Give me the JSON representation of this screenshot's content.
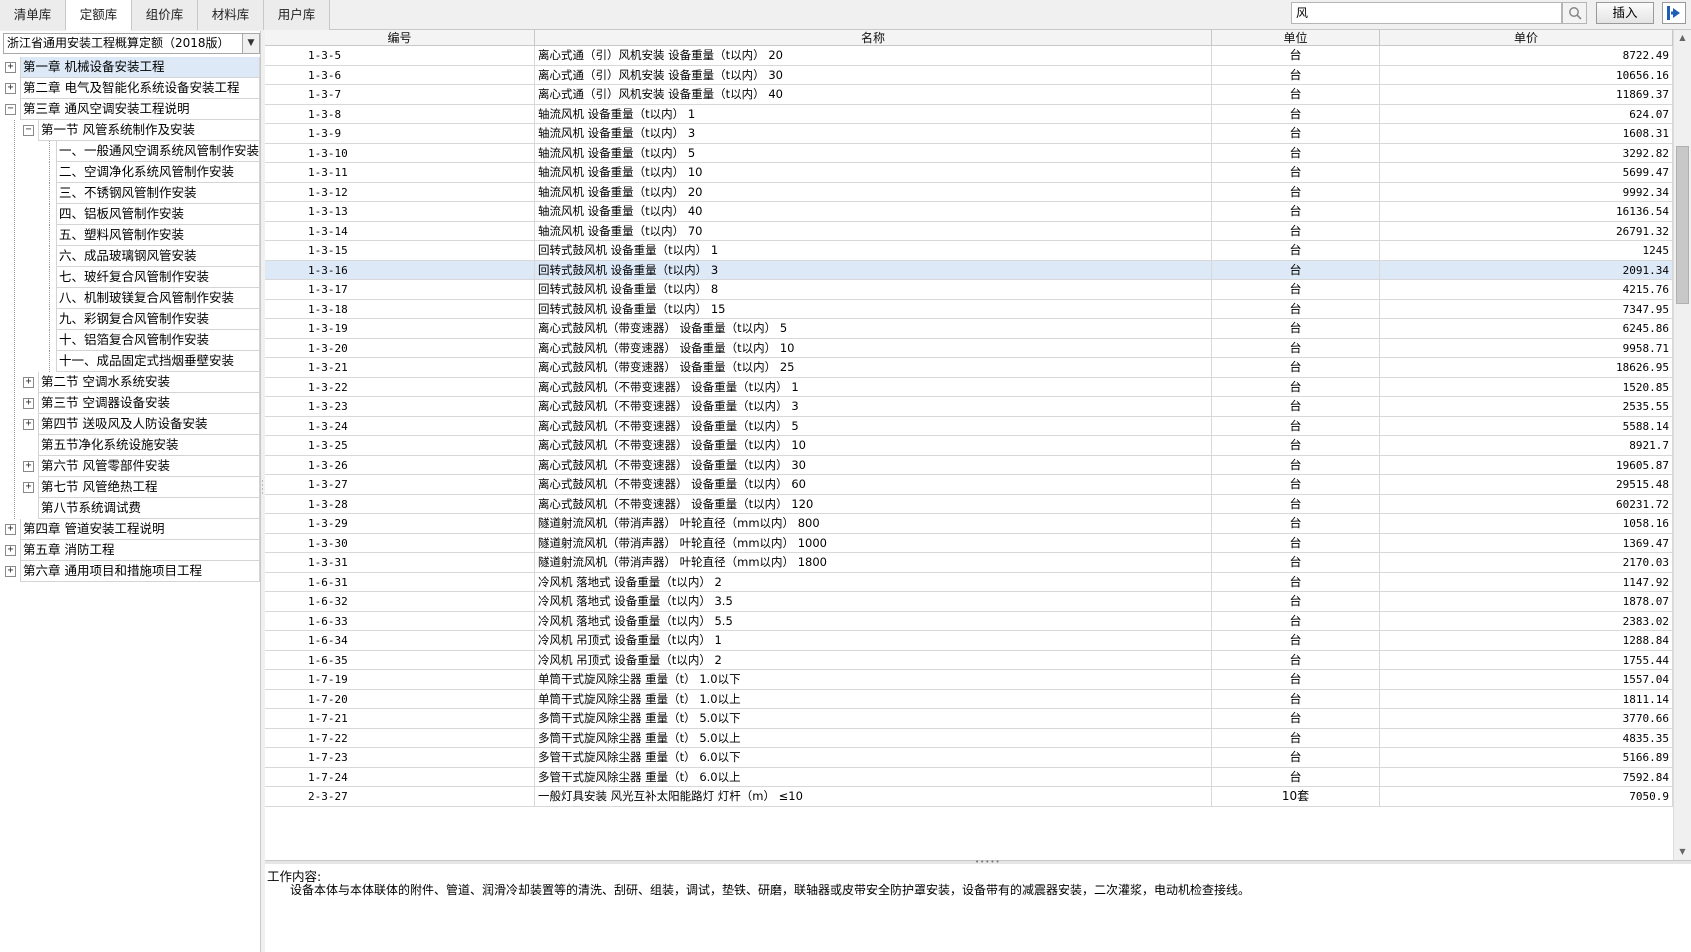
{
  "tabs": [
    "清单库",
    "定额库",
    "组价库",
    "材料库",
    "用户库"
  ],
  "active_tab": 1,
  "search": {
    "value": "风",
    "placeholder": ""
  },
  "insert_label": "插入",
  "left": {
    "combo_value": "浙江省通用安装工程概算定额（2018版）",
    "tree": [
      {
        "label": "第一章 机械设备安装工程",
        "level": 0,
        "expander": "+",
        "selected": true
      },
      {
        "label": "第二章 电气及智能化系统设备安装工程",
        "level": 0,
        "expander": "+"
      },
      {
        "label": "第三章 通风空调安装工程说明",
        "level": 0,
        "expander": "-"
      },
      {
        "label": "第一节 风管系统制作及安装",
        "level": 1,
        "expander": "-"
      },
      {
        "label": "一、一般通风空调系统风管制作安装",
        "level": 2
      },
      {
        "label": "二、空调净化系统风管制作安装",
        "level": 2
      },
      {
        "label": "三、不锈钢风管制作安装",
        "level": 2
      },
      {
        "label": "四、铝板风管制作安装",
        "level": 2
      },
      {
        "label": "五、塑料风管制作安装",
        "level": 2
      },
      {
        "label": "六、成品玻璃钢风管安装",
        "level": 2
      },
      {
        "label": "七、玻纤复合风管制作安装",
        "level": 2
      },
      {
        "label": "八、机制玻镁复合风管制作安装",
        "level": 2
      },
      {
        "label": "九、彩钢复合风管制作安装",
        "level": 2
      },
      {
        "label": "十、铝箔复合风管制作安装",
        "level": 2
      },
      {
        "label": "十一、成品固定式挡烟垂壁安装",
        "level": 2
      },
      {
        "label": "第二节 空调水系统安装",
        "level": 1,
        "expander": "+"
      },
      {
        "label": "第三节 空调器设备安装",
        "level": 1,
        "expander": "+"
      },
      {
        "label": "第四节 送吸风及人防设备安装",
        "level": 1,
        "expander": "+"
      },
      {
        "label": "第五节净化系统设施安装",
        "level": 1
      },
      {
        "label": "第六节 风管零部件安装",
        "level": 1,
        "expander": "+"
      },
      {
        "label": "第七节 风管绝热工程",
        "level": 1,
        "expander": "+"
      },
      {
        "label": "第八节系统调试费",
        "level": 1
      },
      {
        "label": "第四章 管道安装工程说明",
        "level": 0,
        "expander": "+"
      },
      {
        "label": "第五章 消防工程",
        "level": 0,
        "expander": "+"
      },
      {
        "label": "第六章 通用项目和措施项目工程",
        "level": 0,
        "expander": "+"
      }
    ]
  },
  "grid": {
    "headers": [
      "编号",
      "名称",
      "单位",
      "单价"
    ],
    "selected_row": 11,
    "rows": [
      [
        "1-3-5",
        "离心式通（引）风机安装 设备重量（t以内） 20",
        "台",
        "8722.49"
      ],
      [
        "1-3-6",
        "离心式通（引）风机安装 设备重量（t以内） 30",
        "台",
        "10656.16"
      ],
      [
        "1-3-7",
        "离心式通（引）风机安装 设备重量（t以内） 40",
        "台",
        "11869.37"
      ],
      [
        "1-3-8",
        "轴流风机 设备重量（t以内） 1",
        "台",
        "624.07"
      ],
      [
        "1-3-9",
        "轴流风机 设备重量（t以内） 3",
        "台",
        "1608.31"
      ],
      [
        "1-3-10",
        "轴流风机 设备重量（t以内） 5",
        "台",
        "3292.82"
      ],
      [
        "1-3-11",
        "轴流风机 设备重量（t以内） 10",
        "台",
        "5699.47"
      ],
      [
        "1-3-12",
        "轴流风机 设备重量（t以内） 20",
        "台",
        "9992.34"
      ],
      [
        "1-3-13",
        "轴流风机 设备重量（t以内） 40",
        "台",
        "16136.54"
      ],
      [
        "1-3-14",
        "轴流风机 设备重量（t以内） 70",
        "台",
        "26791.32"
      ],
      [
        "1-3-15",
        "回转式鼓风机 设备重量（t以内） 1",
        "台",
        "1245"
      ],
      [
        "1-3-16",
        "回转式鼓风机 设备重量（t以内） 3",
        "台",
        "2091.34"
      ],
      [
        "1-3-17",
        "回转式鼓风机 设备重量（t以内） 8",
        "台",
        "4215.76"
      ],
      [
        "1-3-18",
        "回转式鼓风机 设备重量（t以内） 15",
        "台",
        "7347.95"
      ],
      [
        "1-3-19",
        "离心式鼓风机（带变速器） 设备重量（t以内） 5",
        "台",
        "6245.86"
      ],
      [
        "1-3-20",
        "离心式鼓风机（带变速器） 设备重量（t以内） 10",
        "台",
        "9958.71"
      ],
      [
        "1-3-21",
        "离心式鼓风机（带变速器） 设备重量（t以内） 25",
        "台",
        "18626.95"
      ],
      [
        "1-3-22",
        "离心式鼓风机（不带变速器） 设备重量（t以内） 1",
        "台",
        "1520.85"
      ],
      [
        "1-3-23",
        "离心式鼓风机（不带变速器） 设备重量（t以内） 3",
        "台",
        "2535.55"
      ],
      [
        "1-3-24",
        "离心式鼓风机（不带变速器） 设备重量（t以内） 5",
        "台",
        "5588.14"
      ],
      [
        "1-3-25",
        "离心式鼓风机（不带变速器） 设备重量（t以内） 10",
        "台",
        "8921.7"
      ],
      [
        "1-3-26",
        "离心式鼓风机（不带变速器） 设备重量（t以内） 30",
        "台",
        "19605.87"
      ],
      [
        "1-3-27",
        "离心式鼓风机（不带变速器） 设备重量（t以内） 60",
        "台",
        "29515.48"
      ],
      [
        "1-3-28",
        "离心式鼓风机（不带变速器） 设备重量（t以内） 120",
        "台",
        "60231.72"
      ],
      [
        "1-3-29",
        "隧道射流风机（带消声器） 叶轮直径（mm以内） 800",
        "台",
        "1058.16"
      ],
      [
        "1-3-30",
        "隧道射流风机（带消声器） 叶轮直径（mm以内） 1000",
        "台",
        "1369.47"
      ],
      [
        "1-3-31",
        "隧道射流风机（带消声器） 叶轮直径（mm以内） 1800",
        "台",
        "2170.03"
      ],
      [
        "1-6-31",
        "冷风机 落地式 设备重量（t以内） 2",
        "台",
        "1147.92"
      ],
      [
        "1-6-32",
        "冷风机 落地式 设备重量（t以内） 3.5",
        "台",
        "1878.07"
      ],
      [
        "1-6-33",
        "冷风机 落地式 设备重量（t以内） 5.5",
        "台",
        "2383.02"
      ],
      [
        "1-6-34",
        "冷风机 吊顶式 设备重量（t以内） 1",
        "台",
        "1288.84"
      ],
      [
        "1-6-35",
        "冷风机 吊顶式 设备重量（t以内） 2",
        "台",
        "1755.44"
      ],
      [
        "1-7-19",
        "单筒干式旋风除尘器 重量（t） 1.0以下",
        "台",
        "1557.04"
      ],
      [
        "1-7-20",
        "单筒干式旋风除尘器 重量（t） 1.0以上",
        "台",
        "1811.14"
      ],
      [
        "1-7-21",
        "多筒干式旋风除尘器 重量（t） 5.0以下",
        "台",
        "3770.66"
      ],
      [
        "1-7-22",
        "多筒干式旋风除尘器 重量（t） 5.0以上",
        "台",
        "4835.35"
      ],
      [
        "1-7-23",
        "多管干式旋风除尘器 重量（t） 6.0以下",
        "台",
        "5166.89"
      ],
      [
        "1-7-24",
        "多管干式旋风除尘器 重量（t） 6.0以上",
        "台",
        "7592.84"
      ],
      [
        "2-3-27",
        "一般灯具安装 风光互补太阳能路灯 灯杆（m） ≤10",
        "10套",
        "7050.9"
      ]
    ]
  },
  "detail": {
    "title": "工作内容:",
    "text": "设备本体与本体联体的附件、管道、润滑冷却装置等的清洗、刮研、组装，调试，垫铁、研磨，联轴器或皮带安全防护罩安装，设备带有的减震器安装，二次灌浆，电动机检查接线。"
  },
  "colors": {
    "selection": "#dde9f7",
    "accent": "#1e5fb4"
  },
  "icons": [
    "search-icon",
    "pin-icon",
    "dropdown-arrow-icon",
    "expand-icon",
    "collapse-icon"
  ]
}
